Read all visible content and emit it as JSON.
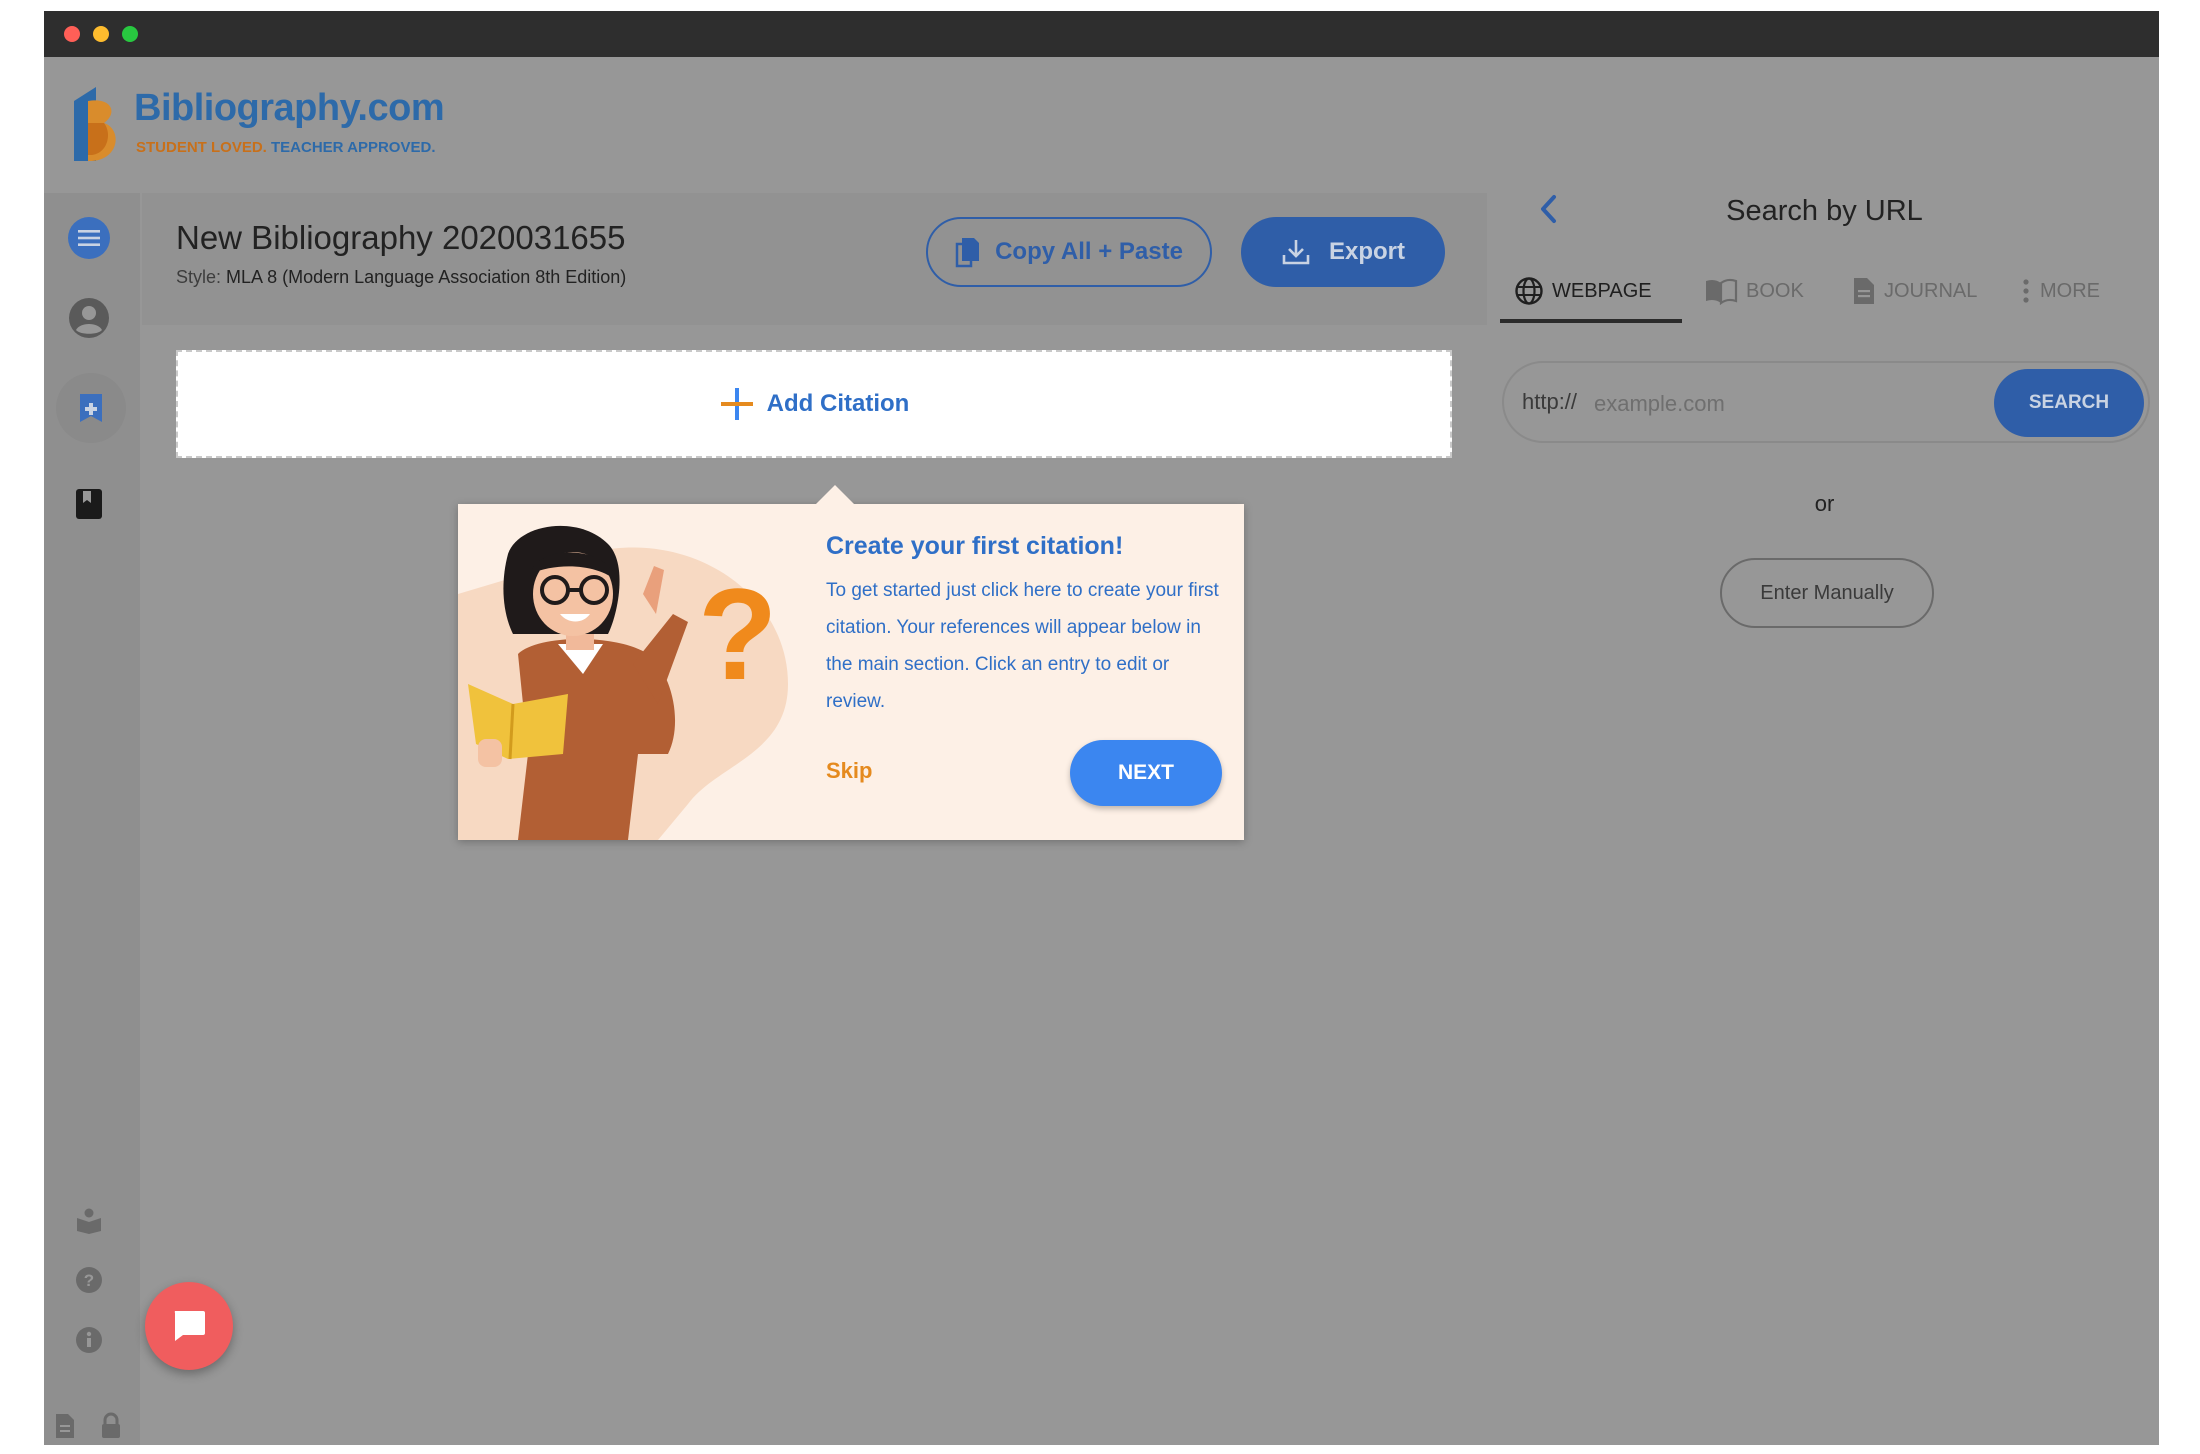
{
  "brand": {
    "name": "Bibliography.com",
    "tagline_part1": "STUDENT LOVED.",
    "tagline_part2": "TEACHER APPROVED."
  },
  "bibliography": {
    "title": "New Bibliography 2020031655",
    "style_label": "Style:",
    "style_value": "MLA 8 (Modern Language Association 8th Edition)"
  },
  "toolbar": {
    "copy_label": "Copy All + Paste",
    "export_label": "Export"
  },
  "add_citation_label": "Add Citation",
  "tutorial": {
    "title": "Create your first citation!",
    "body": "To get started just click here to create your first citation. Your references will appear below in the main section. Click an entry to edit or review.",
    "skip_label": "Skip",
    "next_label": "NEXT"
  },
  "search_panel": {
    "title": "Search by URL",
    "tabs": [
      {
        "label": "WEBPAGE",
        "icon": "globe-icon",
        "active": true
      },
      {
        "label": "BOOK",
        "icon": "book-icon",
        "active": false
      },
      {
        "label": "JOURNAL",
        "icon": "document-icon",
        "active": false
      },
      {
        "label": "MORE",
        "icon": "more-vertical-icon",
        "active": false
      }
    ],
    "url_prefix": "http://",
    "url_placeholder": "example.com",
    "search_label": "SEARCH",
    "or_label": "or",
    "manual_label": "Enter Manually"
  },
  "colors": {
    "brand_blue": "#2d6aa9",
    "brand_orange": "#c8701a",
    "primary_button": "#3b86f0",
    "chat_button": "#f05d5e"
  }
}
